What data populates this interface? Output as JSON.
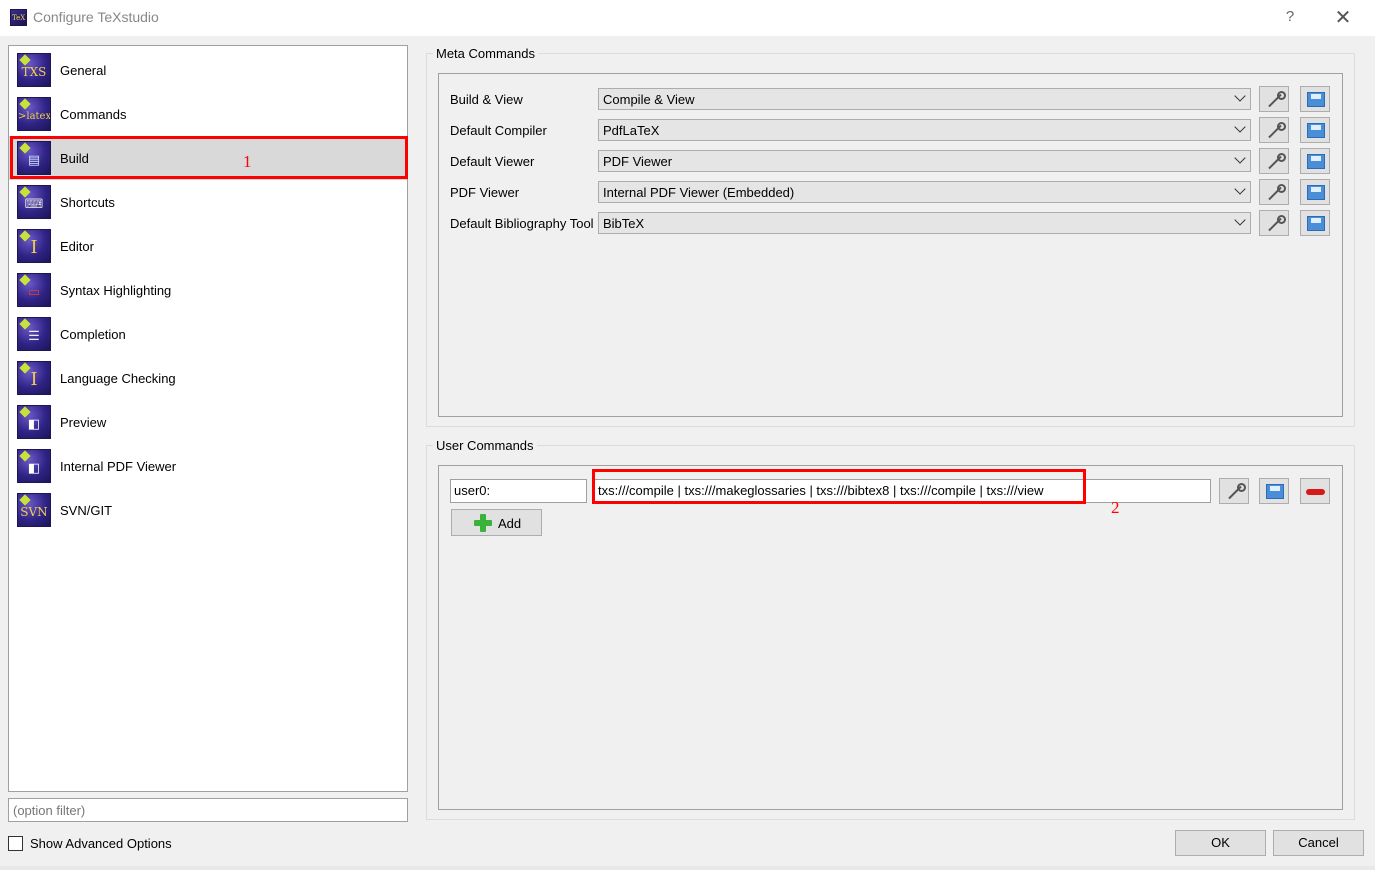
{
  "window": {
    "title": "Configure TeXstudio",
    "help_glyph": "?",
    "close_glyph": "✕"
  },
  "categories": [
    {
      "label": "General",
      "icon": "txs-general-icon",
      "symbol": "TXS"
    },
    {
      "label": "Commands",
      "icon": "latex-commands-icon",
      "symbol": ">latex"
    },
    {
      "label": "Build",
      "icon": "build-icon",
      "symbol": "▤"
    },
    {
      "label": "Shortcuts",
      "icon": "keyboard-icon",
      "symbol": "⌨"
    },
    {
      "label": "Editor",
      "icon": "text-cursor-icon",
      "symbol": "I"
    },
    {
      "label": "Syntax Highlighting",
      "icon": "syntax-highlight-icon",
      "symbol": "▭"
    },
    {
      "label": "Completion",
      "icon": "completion-icon",
      "symbol": "☰"
    },
    {
      "label": "Language Checking",
      "icon": "language-check-icon",
      "symbol": "I"
    },
    {
      "label": "Preview",
      "icon": "preview-icon",
      "symbol": "◧"
    },
    {
      "label": "Internal PDF Viewer",
      "icon": "pdf-viewer-icon",
      "symbol": "◧"
    },
    {
      "label": "SVN/GIT",
      "icon": "svn-git-icon",
      "symbol": "SVN"
    }
  ],
  "selected_category": "Build",
  "filter": {
    "placeholder": "(option filter)",
    "value": ""
  },
  "show_advanced": {
    "label": "Show Advanced Options",
    "checked": false
  },
  "meta": {
    "title": "Meta Commands",
    "rows": [
      {
        "label": "Build & View",
        "value": "Compile & View"
      },
      {
        "label": "Default Compiler",
        "value": "PdfLaTeX"
      },
      {
        "label": "Default Viewer",
        "value": "PDF Viewer"
      },
      {
        "label": "PDF Viewer",
        "value": "Internal PDF Viewer (Embedded)"
      },
      {
        "label": "Default Bibliography Tool",
        "value": "BibTeX"
      }
    ]
  },
  "user": {
    "title": "User Commands",
    "name": "user0:",
    "command": "txs:///compile | txs:///makeglossaries | txs:///bibtex8 | txs:///compile | txs:///view",
    "add_label": "Add"
  },
  "annotations": {
    "one": "1",
    "two": "2"
  },
  "buttons": {
    "ok": "OK",
    "cancel": "Cancel"
  },
  "colors": {
    "highlight": "#ff0000",
    "selected_row": "#d9d9d9",
    "add_icon": "#3bb33b",
    "remove_icon": "#d61a1a"
  }
}
